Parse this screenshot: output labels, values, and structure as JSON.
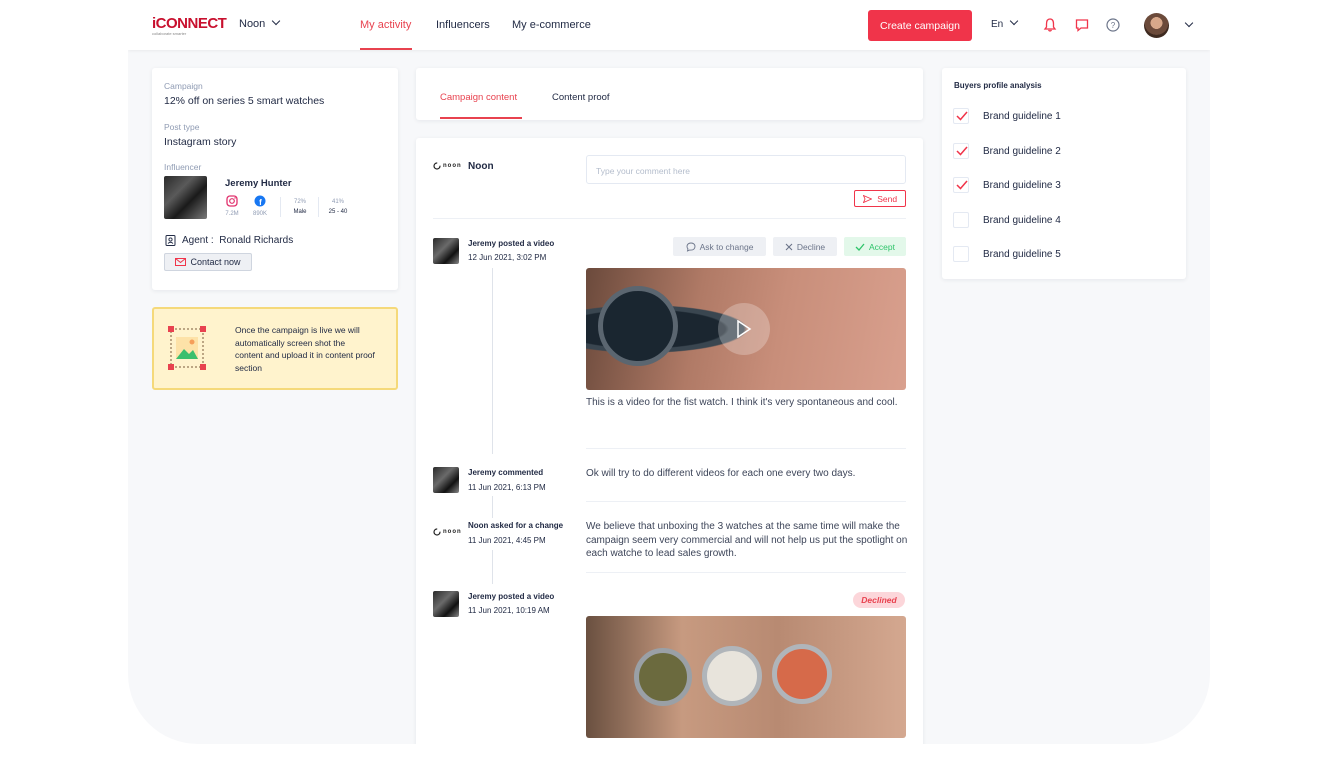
{
  "header": {
    "logo": "iCONNECT",
    "logo_tagline": "collaborate smarter",
    "brand_selector": "Noon",
    "nav": [
      "My activity",
      "Influencers",
      "My e-commerce"
    ],
    "create_button": "Create campaign",
    "language": "En",
    "icons": [
      "bell-icon",
      "chat-icon",
      "help-icon"
    ]
  },
  "campaign_card": {
    "campaign_label": "Campaign",
    "campaign_value": "12% off on series 5 smart watches",
    "post_type_label": "Post type",
    "post_type_value": "Instagram story",
    "influencer_label": "Influencer",
    "influencer_name": "Jeremy Hunter",
    "instagram_followers": "7.2M",
    "facebook_followers": "890K",
    "gender_pct": "72%",
    "gender": "Male",
    "age_pct": "41%",
    "age_range": "25 - 40",
    "agent_label": "Agent :",
    "agent_name": "Ronald Richards",
    "contact_button": "Contact now"
  },
  "info_box": {
    "text": "Once the campaign is live we will automatically screen shot the content and upload it in content proof section"
  },
  "tabs": [
    "Campaign content",
    "Content proof"
  ],
  "comment_box": {
    "brand": "Noon",
    "brand_mark": "noon",
    "placeholder": "Type your comment here",
    "send": "Send"
  },
  "feed": [
    {
      "who": "Jeremy posted a video",
      "when": "12 Jun 2021, 3:02 PM",
      "text": "This is a video for the fist watch. I think it's very spontaneous and cool."
    },
    {
      "who": "Jeremy commented",
      "when": "11 Jun 2021, 6:13 PM",
      "text": "Ok will try to do different videos for each one every two days."
    },
    {
      "who": "Noon asked for a change",
      "when": "11 Jun 2021, 4:45 PM",
      "text": "We believe that unboxing the 3 watches at the same time will make the campaign seem very commercial and will not help us put the spotlight on each watche to lead sales growth."
    },
    {
      "who": "Jeremy posted a video",
      "when": "11 Jun 2021, 10:19 AM",
      "text": "",
      "status": "Declined"
    }
  ],
  "actions": [
    "Ask to change",
    "Decline",
    "Accept"
  ],
  "guidelines": {
    "title": "Buyers profile analysis",
    "items": [
      {
        "label": "Brand guideline 1",
        "checked": true
      },
      {
        "label": "Brand guideline 2",
        "checked": true
      },
      {
        "label": "Brand guideline 3",
        "checked": true
      },
      {
        "label": "Brand guideline 4",
        "checked": false
      },
      {
        "label": "Brand guideline 5",
        "checked": false
      }
    ]
  },
  "colors": {
    "accent": "#f0344a",
    "accept_bg": "#e3f8ea",
    "accept_text": "#2ec46a",
    "info_bg": "#fff3cd"
  }
}
